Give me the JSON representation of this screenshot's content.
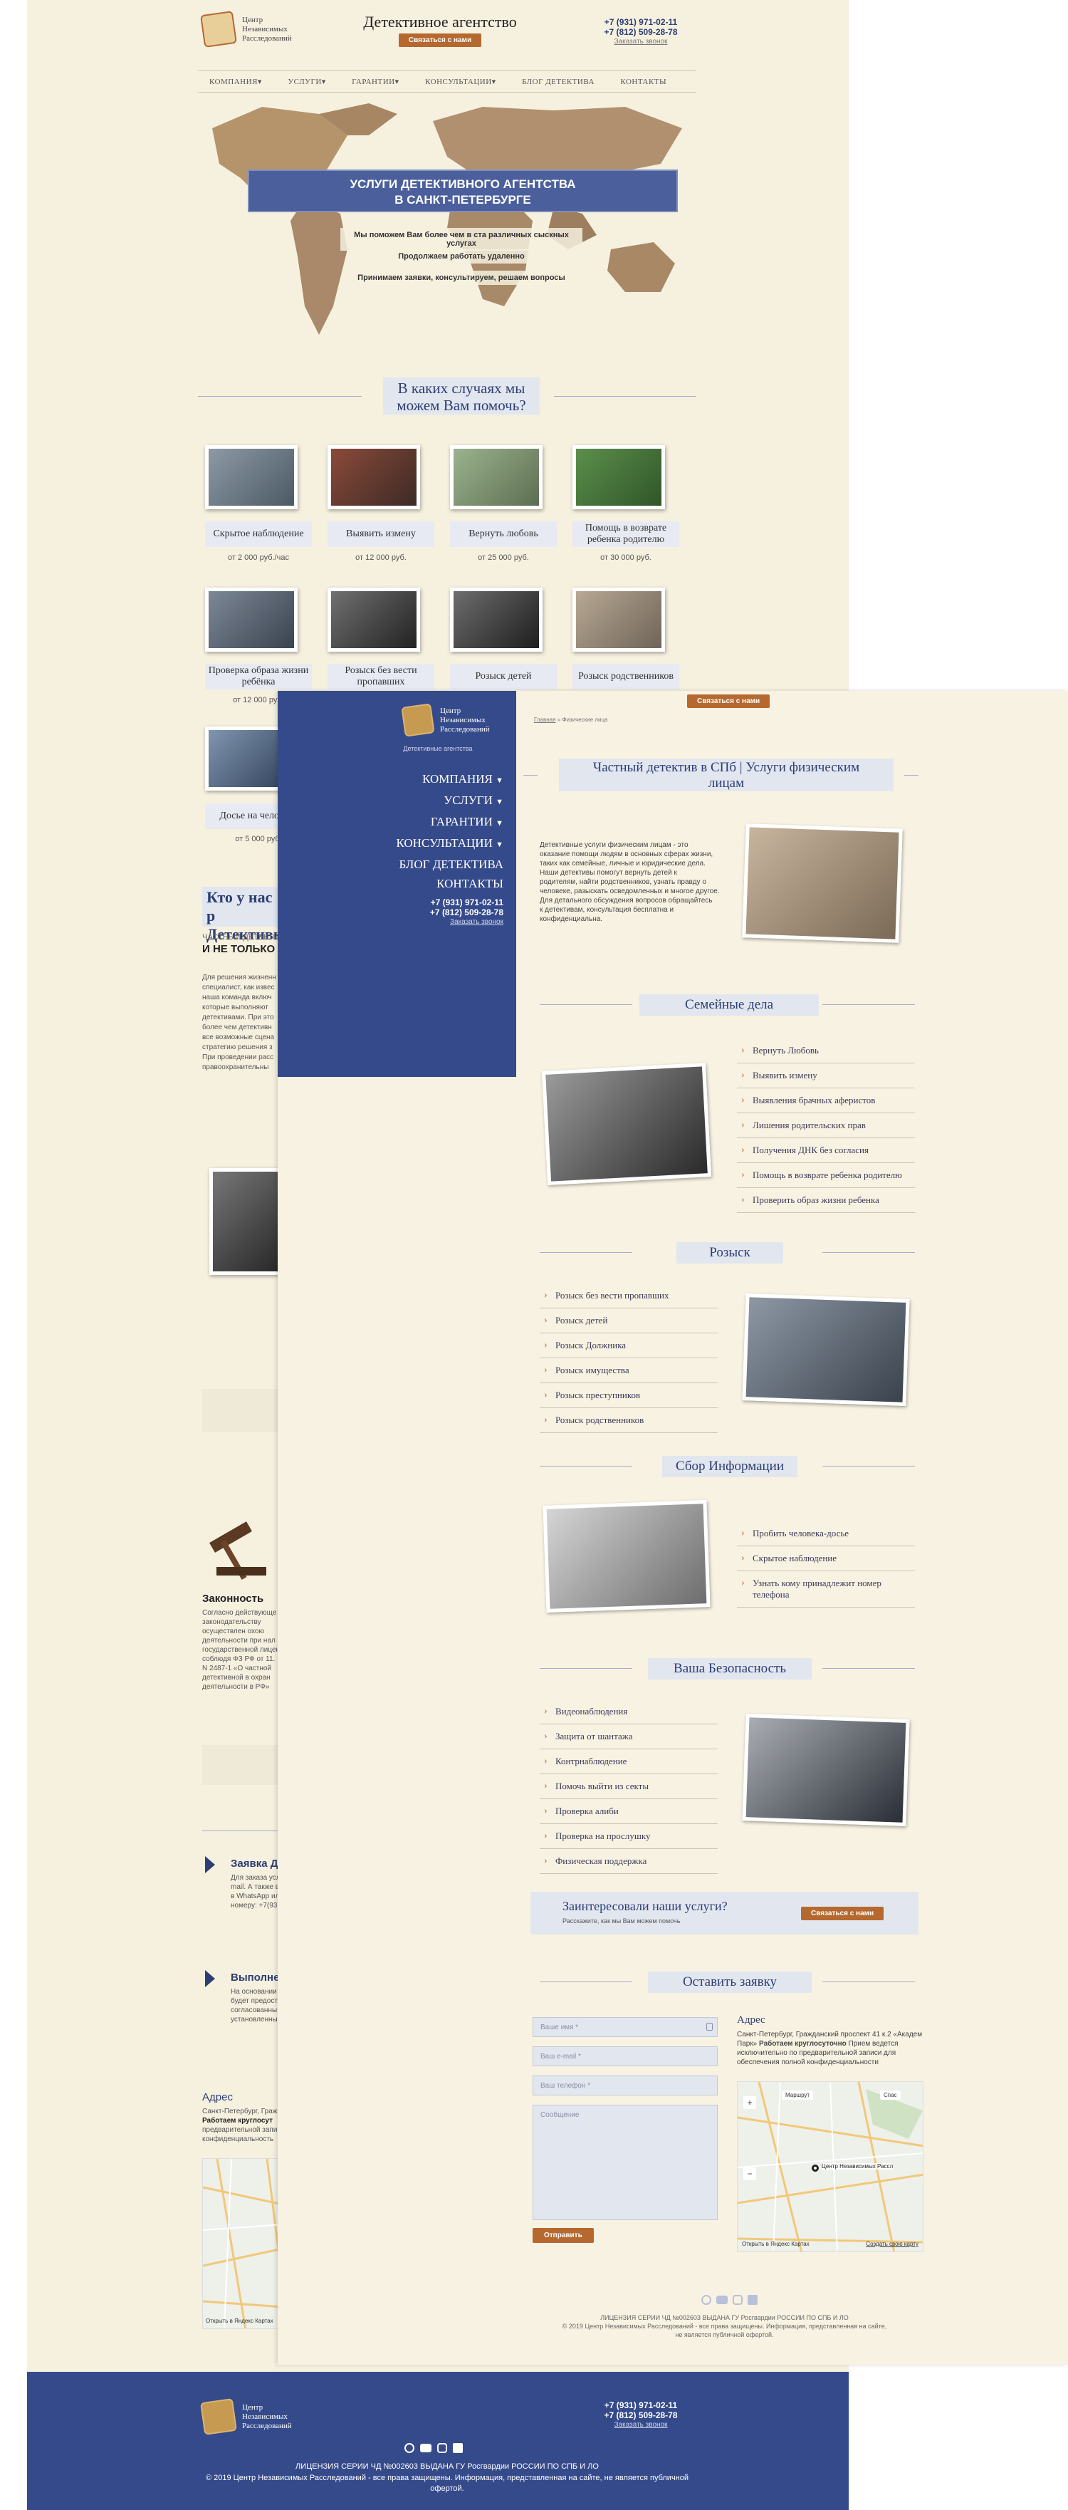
{
  "header": {
    "logo_lines": [
      "Центр",
      "Независимых",
      "Расследований"
    ],
    "agency_title": "Детективное агентство",
    "contact_button": "Связаться с нами",
    "phone1": "+7 (931) 971-02-11",
    "phone2": "+7 (812) 509-28-78",
    "callback_link": "Заказать звонок"
  },
  "nav": [
    "КОМПАНИЯ▾",
    "УСЛУГИ▾",
    "ГАРАНТИИ▾",
    "КОНСУЛЬТАЦИИ▾",
    "БЛОГ ДЕТЕКТИВА",
    "КОНТАКТЫ"
  ],
  "hero": {
    "title_line1": "УСЛУГИ ДЕТЕКТИВНОГО АГЕНТСТВА",
    "title_line2": "В САНКТ-ПЕТЕРБУРГЕ",
    "bullets": [
      "Мы поможем Вам более чем в ста различных сыскных услугах",
      "Продолжаем работать удаленно",
      "Принимаем заявки, консультируем, решаем вопросы"
    ]
  },
  "help_section": {
    "title_line1": "В каких случаях мы",
    "title_line2": "можем Вам помочь?"
  },
  "services": [
    {
      "label": "Скрытое наблюдение",
      "price": "от 2 000 руб./час"
    },
    {
      "label": "Выявить измену",
      "price": "от 12 000 руб."
    },
    {
      "label": "Вернуть любовь",
      "price": "от 25 000 руб."
    },
    {
      "label": "Помощь в возврате ребенка родителю",
      "price": "от 30 000 руб."
    },
    {
      "label": "Проверка образа жизни ребёнка",
      "price": "от 12 000 руб."
    },
    {
      "label": "Розыск без вести пропавших",
      "price": ""
    },
    {
      "label": "Розыск детей",
      "price": ""
    },
    {
      "label": "Розыск родственников",
      "price": ""
    },
    {
      "label": "Досье на человека",
      "price": "от 5 000 руб."
    }
  ],
  "who_section": {
    "title_line1": "Кто у нас р",
    "title_line2": "Детективы",
    "sub1": "ЧАСТНЫЙ ДЕТЕКТИВ",
    "sub2": "И НЕ ТОЛЬКО",
    "paragraph_lines": [
      "Для решения жизненн",
      "специалист, как извес",
      "наша команда включ",
      "которые выполняют",
      "детективами. При это",
      "более чем детективн",
      "все возможные сцена",
      "стратегию решения з",
      "При проведении расс",
      "правоохранительны"
    ]
  },
  "legal_block": {
    "heading": "Законность",
    "lines": [
      "Согласно действующе",
      "законодательству",
      "осуществлен охою",
      "деятельности при нал",
      "государственной лицен",
      "соблюдя ФЗ РФ от 11.",
      "N 2487-1 «О частной",
      "детективной в охран",
      "деятельности в РФ»"
    ]
  },
  "steps": [
    {
      "title": "Заявка Де",
      "lines": [
        "Для заказа усл",
        "mail. А также в",
        "в WhatsApp ил",
        "номеру: +7(93"
      ]
    },
    {
      "title": "Выполнен",
      "lines": [
        "На основании",
        "будет предост",
        "согласованны",
        "установленны"
      ]
    }
  ],
  "address_left": {
    "heading": "Адрес",
    "lines": [
      "Санкт-Петербург, Граж",
      "Работаем круглосут",
      "предварительной запи",
      "конфиденциальность"
    ],
    "map_link": "Открыть в Яндекс Картах"
  },
  "footer": {
    "phone1": "+7 (931) 971-02-11",
    "phone2": "+7 (812) 509-28-78",
    "callback_link": "Заказать звонок",
    "license": "ЛИЦЕНЗИЯ СЕРИИ ЧД №002603 ВЫДАНА ГУ Росгвардии РОССИИ ПО СПБ И ЛО",
    "copyright": "© 2019 Центр Независимых Расследований - все права защищены. Информация, представленная на сайте, не является публичной офертой."
  },
  "overlay": {
    "menu_caption": "Детективные агентства",
    "menu_items": [
      "КОМПАНИЯ",
      "УСЛУГИ",
      "ГАРАНТИИ",
      "КОНСУЛЬТАЦИИ",
      "БЛОГ ДЕТЕКТИВА",
      "КОНТАКТЫ"
    ],
    "phone1": "+7 (931) 971-02-11",
    "phone2": "+7 (812) 509-28-78",
    "callback_link": "Заказать звонок",
    "contact_button": "Связаться с нами",
    "breadcrumb_home": "Главная",
    "breadcrumb_sep": "»",
    "breadcrumb_current": "Физические лица",
    "page_title_line1": "Частный детектив в СПб | Услуги физическим",
    "page_title_line2": "лицам",
    "intro_lines": [
      "Детективные услуги физическим лицам - это",
      "оказание помощи людям в основных сферах жизни,",
      "таких как семейные, личные и юридические дела.",
      "Наши детективы помогут вернуть детей к",
      "родителям, найти родственников, узнать правду о",
      "человеке, разыскать осведомленных и многое другое.",
      "Для детального обсуждения вопросов обращайтесь",
      "к детективам, консультация бесплатна и",
      "конфиденциальна."
    ],
    "family": {
      "title": "Семейные дела",
      "items": [
        "Вернуть Любовь",
        "Выявить измену",
        "Выявления брачных аферистов",
        "Лишения родительских прав",
        "Получения ДНК без согласия",
        "Помощь в возврате ребенка родителю",
        "Проверить образ жизни ребенка"
      ]
    },
    "search": {
      "title": "Розыск",
      "items": [
        "Розыск без вести пропавших",
        "Розыск детей",
        "Розыск Должника",
        "Розыск имущества",
        "Розыск преступников",
        "Розыск родственников"
      ]
    },
    "info": {
      "title": "Сбор Информации",
      "items": [
        "Пробить человека-досье",
        "Скрытое наблюдение",
        "Узнать кому принадлежит номер телефона"
      ]
    },
    "safety": {
      "title": "Ваша Безопасность",
      "items": [
        "Видеонаблюдения",
        "Защита от шантажа",
        "Контрнаблюдение",
        "Помочь выйти из секты",
        "Проверка алиби",
        "Проверка на прослушку",
        "Физическая поддержка"
      ]
    },
    "cta": {
      "title": "Заинтересовали наши услуги?",
      "subtitle": "Расскажите, как мы Вам можем помочь",
      "button": "Связаться с нами"
    },
    "form": {
      "title": "Оставить заявку",
      "name_placeholder": "Ваше имя *",
      "email_placeholder": "Ваш e-mail *",
      "phone_placeholder": "Ваш телефон *",
      "message_placeholder": "Сообщение",
      "submit": "Отправить"
    },
    "address": {
      "heading": "Адрес",
      "text_before": "Санкт-Петербург, Гражданский проспект 41 к.2 «Академ Парк»",
      "bold": "Работаем круглосуточно",
      "text_after": "Прием ведется исключительно по предварительной записи для обеспечения полной конфиденциальности",
      "map_marker_label": "Центр Независимых Рассл",
      "map_btn_route": "Маршрут",
      "map_btn_search": "Спас",
      "map_link": "Открыть в Яндекс Картах",
      "map_author": "Создать свою карту"
    },
    "footer_license": "ЛИЦЕНЗИЯ СЕРИИ ЧД №002603 ВЫДАНА ГУ Росгвардии РОССИИ ПО СПБ И ЛО",
    "footer_copyright_1": "© 2019 Центр Независимых Расследований - все права защищены. Информация, представленная на сайте,",
    "footer_copyright_2": "не является публичной офертой."
  },
  "colors": {
    "accent": "#b5692f",
    "navy": "#354a8a",
    "page_bg": "#f6f0df"
  }
}
